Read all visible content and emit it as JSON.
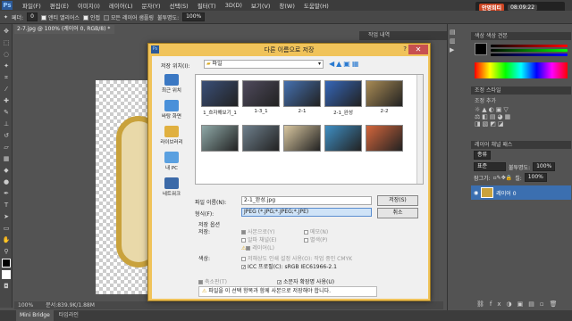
{
  "app": {
    "logo": "Ps"
  },
  "menu": [
    "파일(F)",
    "편집(E)",
    "이미지(I)",
    "레이어(L)",
    "문자(Y)",
    "선택(S)",
    "필터(T)",
    "3D(D)",
    "보기(V)",
    "창(W)",
    "도움말(H)"
  ],
  "options": {
    "feather_label": "페더:",
    "feather_value": "0",
    "antialias": "앤티 앨리어스",
    "contiguous": "인접",
    "all_layers": "모든 레이어 샘플링",
    "opacity_label": "불투명도:",
    "opacity_value": "100%"
  },
  "brand": {
    "name": "안명희티",
    "time": "08:09:22"
  },
  "document": {
    "tab": "2-7.jpg @ 100% (레이어 0, RGB/8) *",
    "zoom": "100%",
    "doc_size": "문서:839.9K/1.88M"
  },
  "bottom_tabs": [
    "Mini Bridge",
    "타임라인"
  ],
  "history_label": "작업 내역",
  "panels": {
    "color_tabs": "색상  색상 견본",
    "adjust_tabs": "조정  스타일",
    "adjust_title": "조정 추가",
    "layers_tabs": "레이어  채널  패스",
    "layer_kind": "종류",
    "layer_mode": "표준",
    "opacity_label": "불투명도:",
    "opacity_value": "100%",
    "lock_label": "잠그기:",
    "fill_label": "칠:",
    "fill_value": "100%",
    "layer_name": "레이어 0"
  },
  "dialog": {
    "title": "다른 이름으로 저장",
    "save_in_label": "저장 위치(I):",
    "save_in_value": "파일",
    "nav": [
      "최근 위치",
      "바탕 화면",
      "라이브러리",
      "내 PC",
      "네트워크"
    ],
    "files": [
      {
        "name": "1_흐자해보기_1",
        "color": "#3a4f77"
      },
      {
        "name": "1-3_1",
        "color": "#4f4a5c"
      },
      {
        "name": "2-1",
        "color": "#4570b0"
      },
      {
        "name": "2-1_완성",
        "color": "#3566b8"
      },
      {
        "name": "2-2",
        "color": "#a88a54"
      },
      {
        "name": "",
        "color": "#8fa9a8"
      },
      {
        "name": "",
        "color": "#6e7f8c"
      },
      {
        "name": "",
        "color": "#d9c7a0"
      },
      {
        "name": "",
        "color": "#3f8fc4"
      },
      {
        "name": "",
        "color": "#d4663c"
      }
    ],
    "filename_label": "파일 이름(N):",
    "filename_value": "2-1_완성.jpg",
    "format_label": "형식(F):",
    "format_value": "JPEG (*.JPG;*.JPEG;*.JPE)",
    "save_button": "저장(S)",
    "cancel_button": "취소",
    "save_options_label": "저장 옵션",
    "save_label": "저장:",
    "opts": {
      "as_copy": "사본으로(Y)",
      "notes": "메모(N)",
      "alpha": "알파 채널(E)",
      "spot": "별색(P)",
      "layers": "레이어(L)"
    },
    "color_label": "색상:",
    "proof_setup": "저해상도 인쇄 설정 사용(O): 작업 중인 CMYK",
    "icc_label": "ICC 프로필(C):",
    "icc_value": "sRGB IEC61966-2.1",
    "thumbnail": "축소판(T)",
    "lowercase": "소문자 확장명 사용(U)",
    "warning": "파일을 이 선택 항목과 함께 사본으로 저장해야 합니다."
  }
}
